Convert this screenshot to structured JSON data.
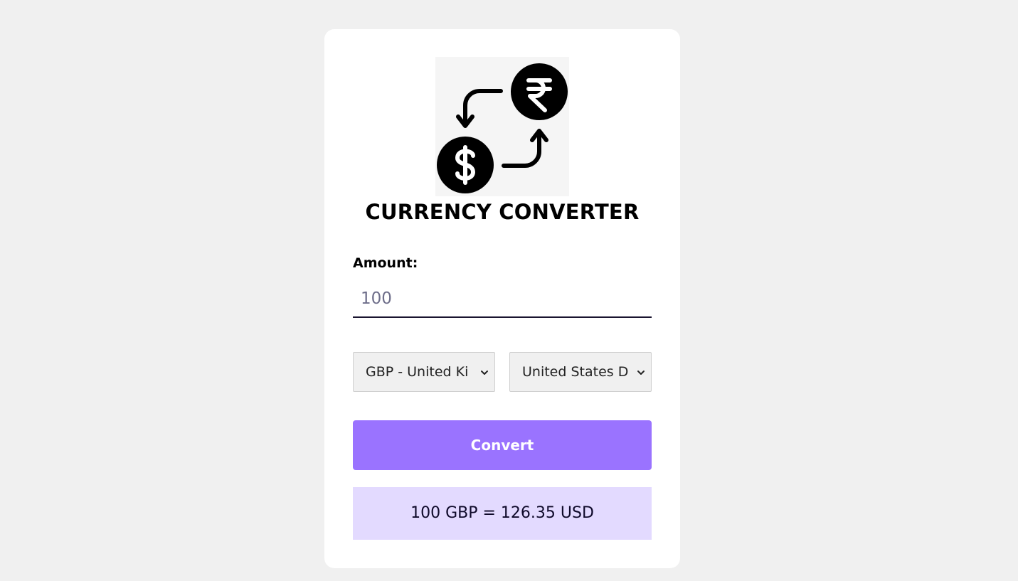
{
  "app": {
    "title": "CURRENCY CONVERTER",
    "logo_icon": "currency-exchange-icon"
  },
  "form": {
    "amount_label": "Amount:",
    "amount_value": "100",
    "from_currency": "GBP - United Ki",
    "to_currency": "United States D",
    "convert_label": "Convert"
  },
  "result": {
    "text": "100 GBP = 126.35 USD"
  },
  "colors": {
    "background": "#f0f0f0",
    "card": "#ffffff",
    "button": "#9a73ff",
    "result_bg": "#e3daff"
  }
}
